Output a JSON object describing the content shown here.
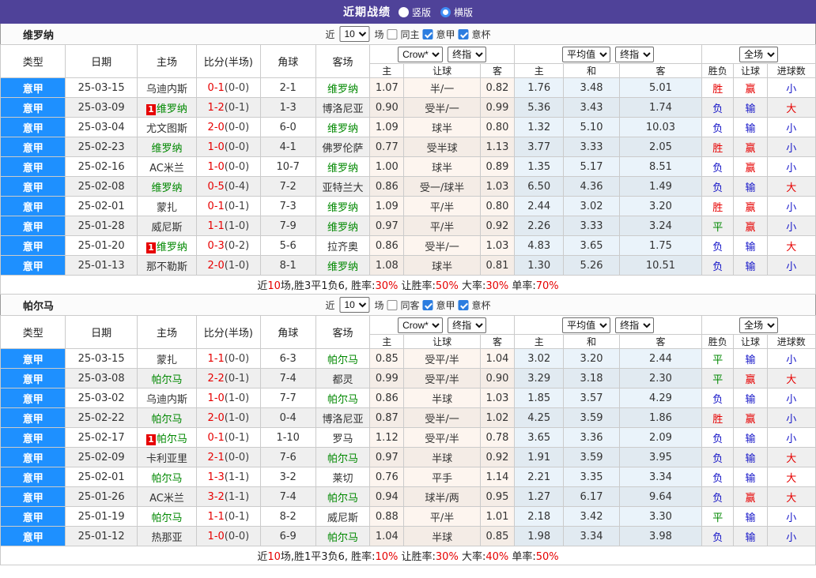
{
  "topbar": {
    "title": "近期战绩",
    "radio_vertical": "竖版",
    "radio_horizontal": "横版",
    "vertical_selected": false,
    "horizontal_selected": true,
    "bg_color": "#4F4299"
  },
  "filter": {
    "near": "近",
    "count": "10",
    "games": "场",
    "league": "意甲",
    "cup": "意杯"
  },
  "header": {
    "col_type": "类型",
    "col_date": "日期",
    "col_home": "主场",
    "col_score": "比分(半场)",
    "col_corner": "角球",
    "col_away": "客场",
    "odds_sub_home": "主",
    "odds_sub_handicap": "让球",
    "odds_sub_away": "客",
    "avg_sub_home": "主",
    "avg_sub_draw": "和",
    "avg_sub_away": "客",
    "res_sub_outcome": "胜负",
    "res_sub_handicap": "让球",
    "res_sub_goals": "进球数",
    "select_crow": "Crow*",
    "select_final1": "终指",
    "select_avg": "平均值",
    "select_final2": "终指",
    "select_full": "全场"
  },
  "colors": {
    "league_bg": "#1E90FF",
    "score_red": "#e60000",
    "team_green": "#008800",
    "result_win_red": "#e60000",
    "result_draw_green": "#008800",
    "result_lose_blue": "#1414c8"
  },
  "result_colors": {
    "胜": "#e60000",
    "平": "#008800",
    "负": "#1414c8",
    "赢": "#e60000",
    "输": "#1414c8",
    "大": "#e60000",
    "小": "#1414c8"
  },
  "sections": [
    {
      "team": "维罗纳",
      "filter": {
        "same_label": "同主",
        "same_checked": false,
        "league_checked": true,
        "cup_checked": true
      },
      "rows": [
        {
          "league": "意甲",
          "date": "25-03-15",
          "home": "乌迪内斯",
          "home_focus": false,
          "home_badge": "",
          "ft": "0-1",
          "ht": "(0-0)",
          "corner": "2-1",
          "away": "维罗纳",
          "away_focus": true,
          "away_badge": "",
          "odds": [
            "1.07",
            "半/一",
            "0.82"
          ],
          "avg": [
            "1.76",
            "3.48",
            "5.01"
          ],
          "res": [
            "胜",
            "赢",
            "小"
          ]
        },
        {
          "league": "意甲",
          "date": "25-03-09",
          "home": "维罗纳",
          "home_focus": true,
          "home_badge": "1",
          "ft": "1-2",
          "ht": "(0-1)",
          "corner": "1-3",
          "away": "博洛尼亚",
          "away_focus": false,
          "away_badge": "",
          "odds": [
            "0.90",
            "受半/一",
            "0.99"
          ],
          "avg": [
            "5.36",
            "3.43",
            "1.74"
          ],
          "res": [
            "负",
            "输",
            "大"
          ]
        },
        {
          "league": "意甲",
          "date": "25-03-04",
          "home": "尤文图斯",
          "home_focus": false,
          "home_badge": "",
          "ft": "2-0",
          "ht": "(0-0)",
          "corner": "6-0",
          "away": "维罗纳",
          "away_focus": true,
          "away_badge": "",
          "odds": [
            "1.09",
            "球半",
            "0.80"
          ],
          "avg": [
            "1.32",
            "5.10",
            "10.03"
          ],
          "res": [
            "负",
            "输",
            "小"
          ]
        },
        {
          "league": "意甲",
          "date": "25-02-23",
          "home": "维罗纳",
          "home_focus": true,
          "home_badge": "",
          "ft": "1-0",
          "ht": "(0-0)",
          "corner": "4-1",
          "away": "佛罗伦萨",
          "away_focus": false,
          "away_badge": "",
          "odds": [
            "0.77",
            "受半球",
            "1.13"
          ],
          "avg": [
            "3.77",
            "3.33",
            "2.05"
          ],
          "res": [
            "胜",
            "赢",
            "小"
          ]
        },
        {
          "league": "意甲",
          "date": "25-02-16",
          "home": "AC米兰",
          "home_focus": false,
          "home_badge": "",
          "ft": "1-0",
          "ht": "(0-0)",
          "corner": "10-7",
          "away": "维罗纳",
          "away_focus": true,
          "away_badge": "",
          "odds": [
            "1.00",
            "球半",
            "0.89"
          ],
          "avg": [
            "1.35",
            "5.17",
            "8.51"
          ],
          "res": [
            "负",
            "赢",
            "小"
          ]
        },
        {
          "league": "意甲",
          "date": "25-02-08",
          "home": "维罗纳",
          "home_focus": true,
          "home_badge": "",
          "ft": "0-5",
          "ht": "(0-4)",
          "corner": "7-2",
          "away": "亚特兰大",
          "away_focus": false,
          "away_badge": "",
          "odds": [
            "0.86",
            "受一/球半",
            "1.03"
          ],
          "avg": [
            "6.50",
            "4.36",
            "1.49"
          ],
          "res": [
            "负",
            "输",
            "大"
          ]
        },
        {
          "league": "意甲",
          "date": "25-02-01",
          "home": "蒙扎",
          "home_focus": false,
          "home_badge": "",
          "ft": "0-1",
          "ht": "(0-1)",
          "corner": "7-3",
          "away": "维罗纳",
          "away_focus": true,
          "away_badge": "",
          "odds": [
            "1.09",
            "平/半",
            "0.80"
          ],
          "avg": [
            "2.44",
            "3.02",
            "3.20"
          ],
          "res": [
            "胜",
            "赢",
            "小"
          ]
        },
        {
          "league": "意甲",
          "date": "25-01-28",
          "home": "威尼斯",
          "home_focus": false,
          "home_badge": "",
          "ft": "1-1",
          "ht": "(1-0)",
          "corner": "7-9",
          "away": "维罗纳",
          "away_focus": true,
          "away_badge": "",
          "odds": [
            "0.97",
            "平/半",
            "0.92"
          ],
          "avg": [
            "2.26",
            "3.33",
            "3.24"
          ],
          "res": [
            "平",
            "赢",
            "小"
          ]
        },
        {
          "league": "意甲",
          "date": "25-01-20",
          "home": "维罗纳",
          "home_focus": true,
          "home_badge": "1",
          "ft": "0-3",
          "ht": "(0-2)",
          "corner": "5-6",
          "away": "拉齐奥",
          "away_focus": false,
          "away_badge": "",
          "odds": [
            "0.86",
            "受半/一",
            "1.03"
          ],
          "avg": [
            "4.83",
            "3.65",
            "1.75"
          ],
          "res": [
            "负",
            "输",
            "大"
          ]
        },
        {
          "league": "意甲",
          "date": "25-01-13",
          "home": "那不勒斯",
          "home_focus": false,
          "home_badge": "",
          "ft": "2-0",
          "ht": "(1-0)",
          "corner": "8-1",
          "away": "维罗纳",
          "away_focus": true,
          "away_badge": "",
          "odds": [
            "1.08",
            "球半",
            "0.81"
          ],
          "avg": [
            "1.30",
            "5.26",
            "10.51"
          ],
          "res": [
            "负",
            "输",
            "小"
          ]
        }
      ],
      "summary": [
        {
          "t": "近",
          "r": false
        },
        {
          "t": "10",
          "r": true
        },
        {
          "t": "场,胜3平1负6, 胜率:",
          "r": false
        },
        {
          "t": "30%",
          "r": true
        },
        {
          "t": " 让胜率:",
          "r": false
        },
        {
          "t": "50%",
          "r": true
        },
        {
          "t": " 大率:",
          "r": false
        },
        {
          "t": "30%",
          "r": true
        },
        {
          "t": " 单率:",
          "r": false
        },
        {
          "t": "70%",
          "r": true
        }
      ]
    },
    {
      "team": "帕尔马",
      "filter": {
        "same_label": "同客",
        "same_checked": false,
        "league_checked": true,
        "cup_checked": true
      },
      "rows": [
        {
          "league": "意甲",
          "date": "25-03-15",
          "home": "蒙扎",
          "home_focus": false,
          "home_badge": "",
          "ft": "1-1",
          "ht": "(0-0)",
          "corner": "6-3",
          "away": "帕尔马",
          "away_focus": true,
          "away_badge": "",
          "odds": [
            "0.85",
            "受平/半",
            "1.04"
          ],
          "avg": [
            "3.02",
            "3.20",
            "2.44"
          ],
          "res": [
            "平",
            "输",
            "小"
          ]
        },
        {
          "league": "意甲",
          "date": "25-03-08",
          "home": "帕尔马",
          "home_focus": true,
          "home_badge": "",
          "ft": "2-2",
          "ht": "(0-1)",
          "corner": "7-4",
          "away": "都灵",
          "away_focus": false,
          "away_badge": "",
          "odds": [
            "0.99",
            "受平/半",
            "0.90"
          ],
          "avg": [
            "3.29",
            "3.18",
            "2.30"
          ],
          "res": [
            "平",
            "赢",
            "大"
          ]
        },
        {
          "league": "意甲",
          "date": "25-03-02",
          "home": "乌迪内斯",
          "home_focus": false,
          "home_badge": "",
          "ft": "1-0",
          "ht": "(1-0)",
          "corner": "7-7",
          "away": "帕尔马",
          "away_focus": true,
          "away_badge": "",
          "odds": [
            "0.86",
            "半球",
            "1.03"
          ],
          "avg": [
            "1.85",
            "3.57",
            "4.29"
          ],
          "res": [
            "负",
            "输",
            "小"
          ]
        },
        {
          "league": "意甲",
          "date": "25-02-22",
          "home": "帕尔马",
          "home_focus": true,
          "home_badge": "",
          "ft": "2-0",
          "ht": "(1-0)",
          "corner": "0-4",
          "away": "博洛尼亚",
          "away_focus": false,
          "away_badge": "",
          "odds": [
            "0.87",
            "受半/一",
            "1.02"
          ],
          "avg": [
            "4.25",
            "3.59",
            "1.86"
          ],
          "res": [
            "胜",
            "赢",
            "小"
          ]
        },
        {
          "league": "意甲",
          "date": "25-02-17",
          "home": "帕尔马",
          "home_focus": true,
          "home_badge": "1",
          "ft": "0-1",
          "ht": "(0-1)",
          "corner": "1-10",
          "away": "罗马",
          "away_focus": false,
          "away_badge": "",
          "odds": [
            "1.12",
            "受平/半",
            "0.78"
          ],
          "avg": [
            "3.65",
            "3.36",
            "2.09"
          ],
          "res": [
            "负",
            "输",
            "小"
          ]
        },
        {
          "league": "意甲",
          "date": "25-02-09",
          "home": "卡利亚里",
          "home_focus": false,
          "home_badge": "",
          "ft": "2-1",
          "ht": "(0-0)",
          "corner": "7-6",
          "away": "帕尔马",
          "away_focus": true,
          "away_badge": "",
          "odds": [
            "0.97",
            "半球",
            "0.92"
          ],
          "avg": [
            "1.91",
            "3.59",
            "3.95"
          ],
          "res": [
            "负",
            "输",
            "大"
          ]
        },
        {
          "league": "意甲",
          "date": "25-02-01",
          "home": "帕尔马",
          "home_focus": true,
          "home_badge": "",
          "ft": "1-3",
          "ht": "(1-1)",
          "corner": "3-2",
          "away": "莱切",
          "away_focus": false,
          "away_badge": "",
          "odds": [
            "0.76",
            "平手",
            "1.14"
          ],
          "avg": [
            "2.21",
            "3.35",
            "3.34"
          ],
          "res": [
            "负",
            "输",
            "大"
          ]
        },
        {
          "league": "意甲",
          "date": "25-01-26",
          "home": "AC米兰",
          "home_focus": false,
          "home_badge": "",
          "ft": "3-2",
          "ht": "(1-1)",
          "corner": "7-4",
          "away": "帕尔马",
          "away_focus": true,
          "away_badge": "",
          "odds": [
            "0.94",
            "球半/两",
            "0.95"
          ],
          "avg": [
            "1.27",
            "6.17",
            "9.64"
          ],
          "res": [
            "负",
            "赢",
            "大"
          ]
        },
        {
          "league": "意甲",
          "date": "25-01-19",
          "home": "帕尔马",
          "home_focus": true,
          "home_badge": "",
          "ft": "1-1",
          "ht": "(0-1)",
          "corner": "8-2",
          "away": "威尼斯",
          "away_focus": false,
          "away_badge": "",
          "odds": [
            "0.88",
            "平/半",
            "1.01"
          ],
          "avg": [
            "2.18",
            "3.42",
            "3.30"
          ],
          "res": [
            "平",
            "输",
            "小"
          ]
        },
        {
          "league": "意甲",
          "date": "25-01-12",
          "home": "热那亚",
          "home_focus": false,
          "home_badge": "",
          "ft": "1-0",
          "ht": "(0-0)",
          "corner": "6-9",
          "away": "帕尔马",
          "away_focus": true,
          "away_badge": "",
          "odds": [
            "1.04",
            "半球",
            "0.85"
          ],
          "avg": [
            "1.98",
            "3.34",
            "3.98"
          ],
          "res": [
            "负",
            "输",
            "小"
          ]
        }
      ],
      "summary": [
        {
          "t": "近",
          "r": false
        },
        {
          "t": "10",
          "r": true
        },
        {
          "t": "场,胜1平3负6, 胜率:",
          "r": false
        },
        {
          "t": "10%",
          "r": true
        },
        {
          "t": " 让胜率:",
          "r": false
        },
        {
          "t": "30%",
          "r": true
        },
        {
          "t": " 大率:",
          "r": false
        },
        {
          "t": "40%",
          "r": true
        },
        {
          "t": " 单率:",
          "r": false
        },
        {
          "t": "50%",
          "r": true
        }
      ]
    }
  ]
}
